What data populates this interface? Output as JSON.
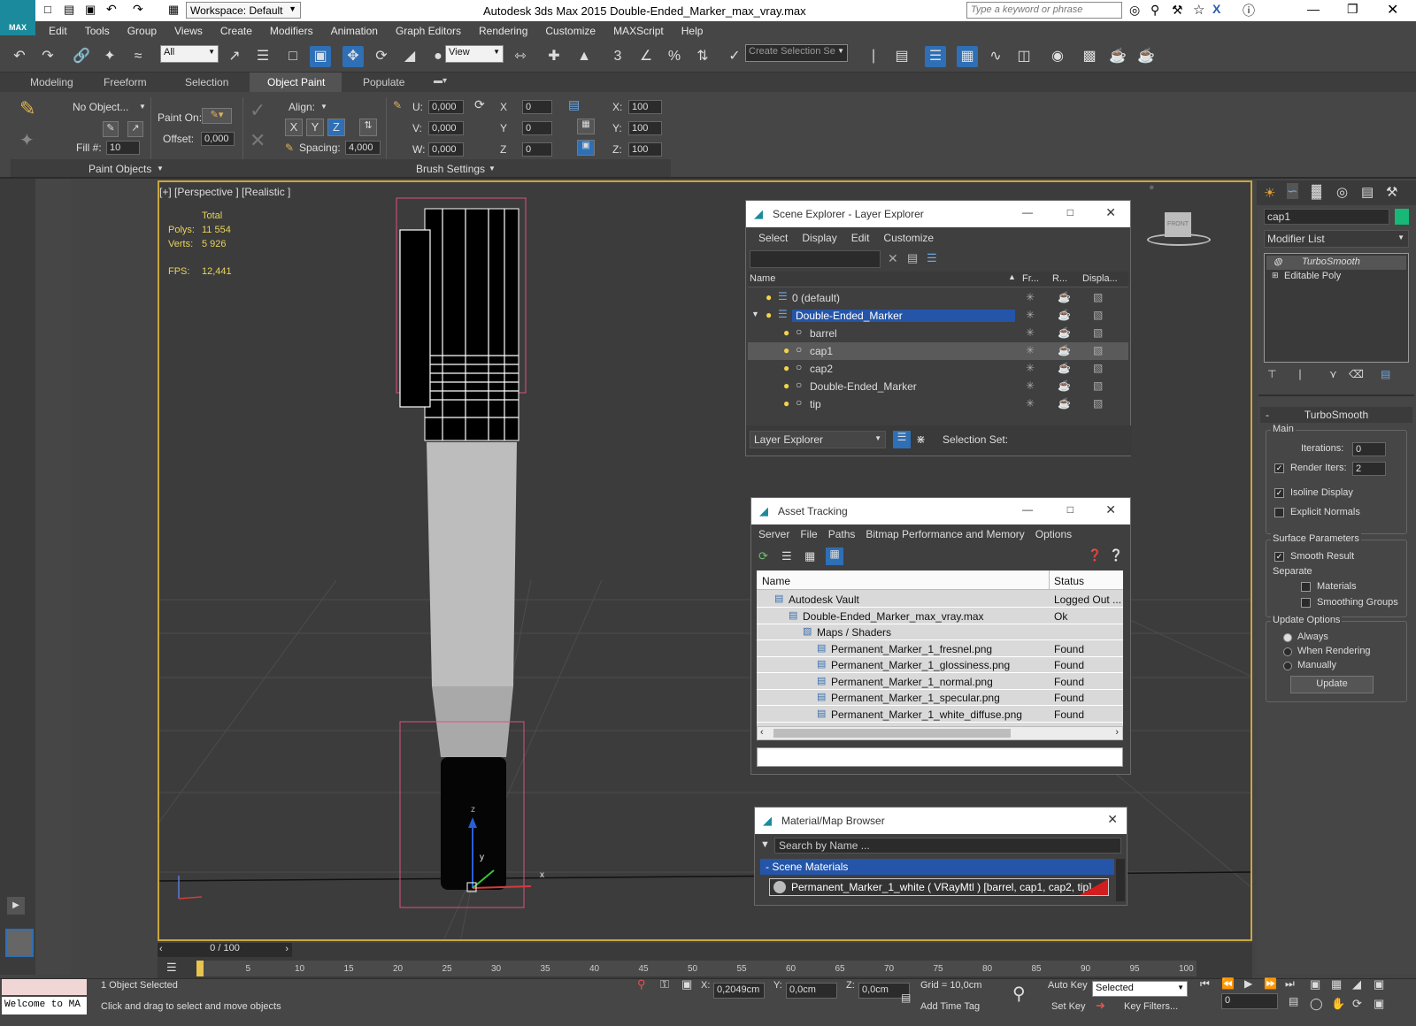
{
  "titlebar": {
    "app_title": "Autodesk 3ds Max  2015    Double-Ended_Marker_max_vray.max",
    "workspace": "Workspace: Default",
    "search_placeholder": "Type a keyword or phrase",
    "logo": "MAX"
  },
  "menubar": {
    "items": [
      "Edit",
      "Tools",
      "Group",
      "Views",
      "Create",
      "Modifiers",
      "Animation",
      "Graph Editors",
      "Rendering",
      "Customize",
      "MAXScript",
      "Help"
    ]
  },
  "toolbar": {
    "filter": "All",
    "ref_coord": "View",
    "selection_set": "Create Selection Se"
  },
  "ribbon": {
    "tabs": [
      "Modeling",
      "Freeform",
      "Selection",
      "Object Paint",
      "Populate"
    ],
    "active_tab": "Object Paint",
    "no_object": "No Object...",
    "paint_on": "Paint On:",
    "offset_label": "Offset:",
    "offset_value": "0,000",
    "fill_label": "Fill #:",
    "fill_value": "10",
    "align_label": "Align:",
    "axes": [
      "X",
      "Y",
      "Z"
    ],
    "spacing_label": "Spacing:",
    "spacing_value": "4,000",
    "u_label": "U:",
    "u_value": "0,000",
    "v_label": "V:",
    "v_value": "0,000",
    "w_label": "W:",
    "w_value": "0,000",
    "rx_label": "X",
    "rx_value": "0",
    "ry_label": "Y",
    "ry_value": "0",
    "rz_label": "Z",
    "rz_value": "0",
    "sx_label": "X:",
    "sx_value": "100",
    "sy_label": "Y:",
    "sy_value": "100",
    "sz_label": "Z:",
    "sz_value": "100",
    "group1": "Paint Objects",
    "group2": "Brush Settings"
  },
  "viewport": {
    "label": "[+] [Perspective ] [Realistic ]",
    "stats_header": "Total",
    "polys_label": "Polys:",
    "polys": "11 554",
    "verts_label": "Verts:",
    "verts": "5 926",
    "fps_label": "FPS:",
    "fps": "12,441",
    "viewcube": "FRONT",
    "gizmo": {
      "z": "z",
      "y": "y",
      "x": "x"
    }
  },
  "scene_explorer": {
    "title": "Scene Explorer - Layer Explorer",
    "menu": [
      "Select",
      "Display",
      "Edit",
      "Customize"
    ],
    "columns": [
      "Name",
      "Fr...",
      "R...",
      "Displa..."
    ],
    "rows": [
      {
        "name": "0 (default)",
        "indent": 0
      },
      {
        "name": "Double-Ended_Marker",
        "indent": 0,
        "selected": true
      },
      {
        "name": "barrel",
        "indent": 1
      },
      {
        "name": "cap1",
        "indent": 1,
        "highlight": true
      },
      {
        "name": "cap2",
        "indent": 1
      },
      {
        "name": "Double-Ended_Marker",
        "indent": 1
      },
      {
        "name": "tip",
        "indent": 1
      }
    ],
    "footer_combo": "Layer Explorer",
    "selection_set": "Selection Set:"
  },
  "asset_tracking": {
    "title": "Asset Tracking",
    "menu": [
      "Server",
      "File",
      "Paths",
      "Bitmap Performance and Memory",
      "Options"
    ],
    "columns": [
      "Name",
      "Status"
    ],
    "rows": [
      {
        "name": "Autodesk Vault",
        "status": "Logged Out ...",
        "indent": 1
      },
      {
        "name": "Double-Ended_Marker_max_vray.max",
        "status": "Ok",
        "indent": 2
      },
      {
        "name": "Maps / Shaders",
        "status": "",
        "indent": 3
      },
      {
        "name": "Permanent_Marker_1_fresnel.png",
        "status": "Found",
        "indent": 4
      },
      {
        "name": "Permanent_Marker_1_glossiness.png",
        "status": "Found",
        "indent": 4
      },
      {
        "name": "Permanent_Marker_1_normal.png",
        "status": "Found",
        "indent": 4
      },
      {
        "name": "Permanent_Marker_1_specular.png",
        "status": "Found",
        "indent": 4
      },
      {
        "name": "Permanent_Marker_1_white_diffuse.png",
        "status": "Found",
        "indent": 4
      }
    ]
  },
  "material_browser": {
    "title": "Material/Map Browser",
    "search_placeholder": "Search by Name ...",
    "group": "- Scene Materials",
    "item": "Permanent_Marker_1_white  ( VRayMtl )  [barrel, cap1, cap2, tip]"
  },
  "command_panel": {
    "object_name": "cap1",
    "modifier_list": "Modifier List",
    "stack": [
      "TurboSmooth",
      "Editable Poly"
    ],
    "rollout": "TurboSmooth",
    "main": "Main",
    "iterations_label": "Iterations:",
    "iterations": "0",
    "render_iters_label": "Render Iters:",
    "render_iters": "2",
    "isoline": "Isoline Display",
    "explicit": "Explicit Normals",
    "surface": "Surface Parameters",
    "smooth_result": "Smooth Result",
    "separate": "Separate",
    "materials": "Materials",
    "smoothing_groups": "Smoothing Groups",
    "update_options": "Update Options",
    "always": "Always",
    "when_rendering": "When Rendering",
    "manually": "Manually",
    "update_button": "Update"
  },
  "timeline": {
    "frame": "0 / 100",
    "ticks": [
      "0",
      "5",
      "10",
      "15",
      "20",
      "25",
      "30",
      "35",
      "40",
      "45",
      "50",
      "55",
      "60",
      "65",
      "70",
      "75",
      "80",
      "85",
      "90",
      "95",
      "100"
    ]
  },
  "status": {
    "selected": "1 Object Selected",
    "prompt": "Click and drag to select and move objects",
    "welcome": "Welcome to MA",
    "x_label": "X:",
    "x": "0,2049cm",
    "y_label": "Y:",
    "y": "0,0cm",
    "z_label": "Z:",
    "z": "0,0cm",
    "grid": "Grid = 10,0cm",
    "auto_key": "Auto Key",
    "set_key": "Set Key",
    "selected_combo": "Selected",
    "key_filters": "Key Filters...",
    "add_time_tag": "Add Time Tag",
    "frame_value": "0"
  }
}
